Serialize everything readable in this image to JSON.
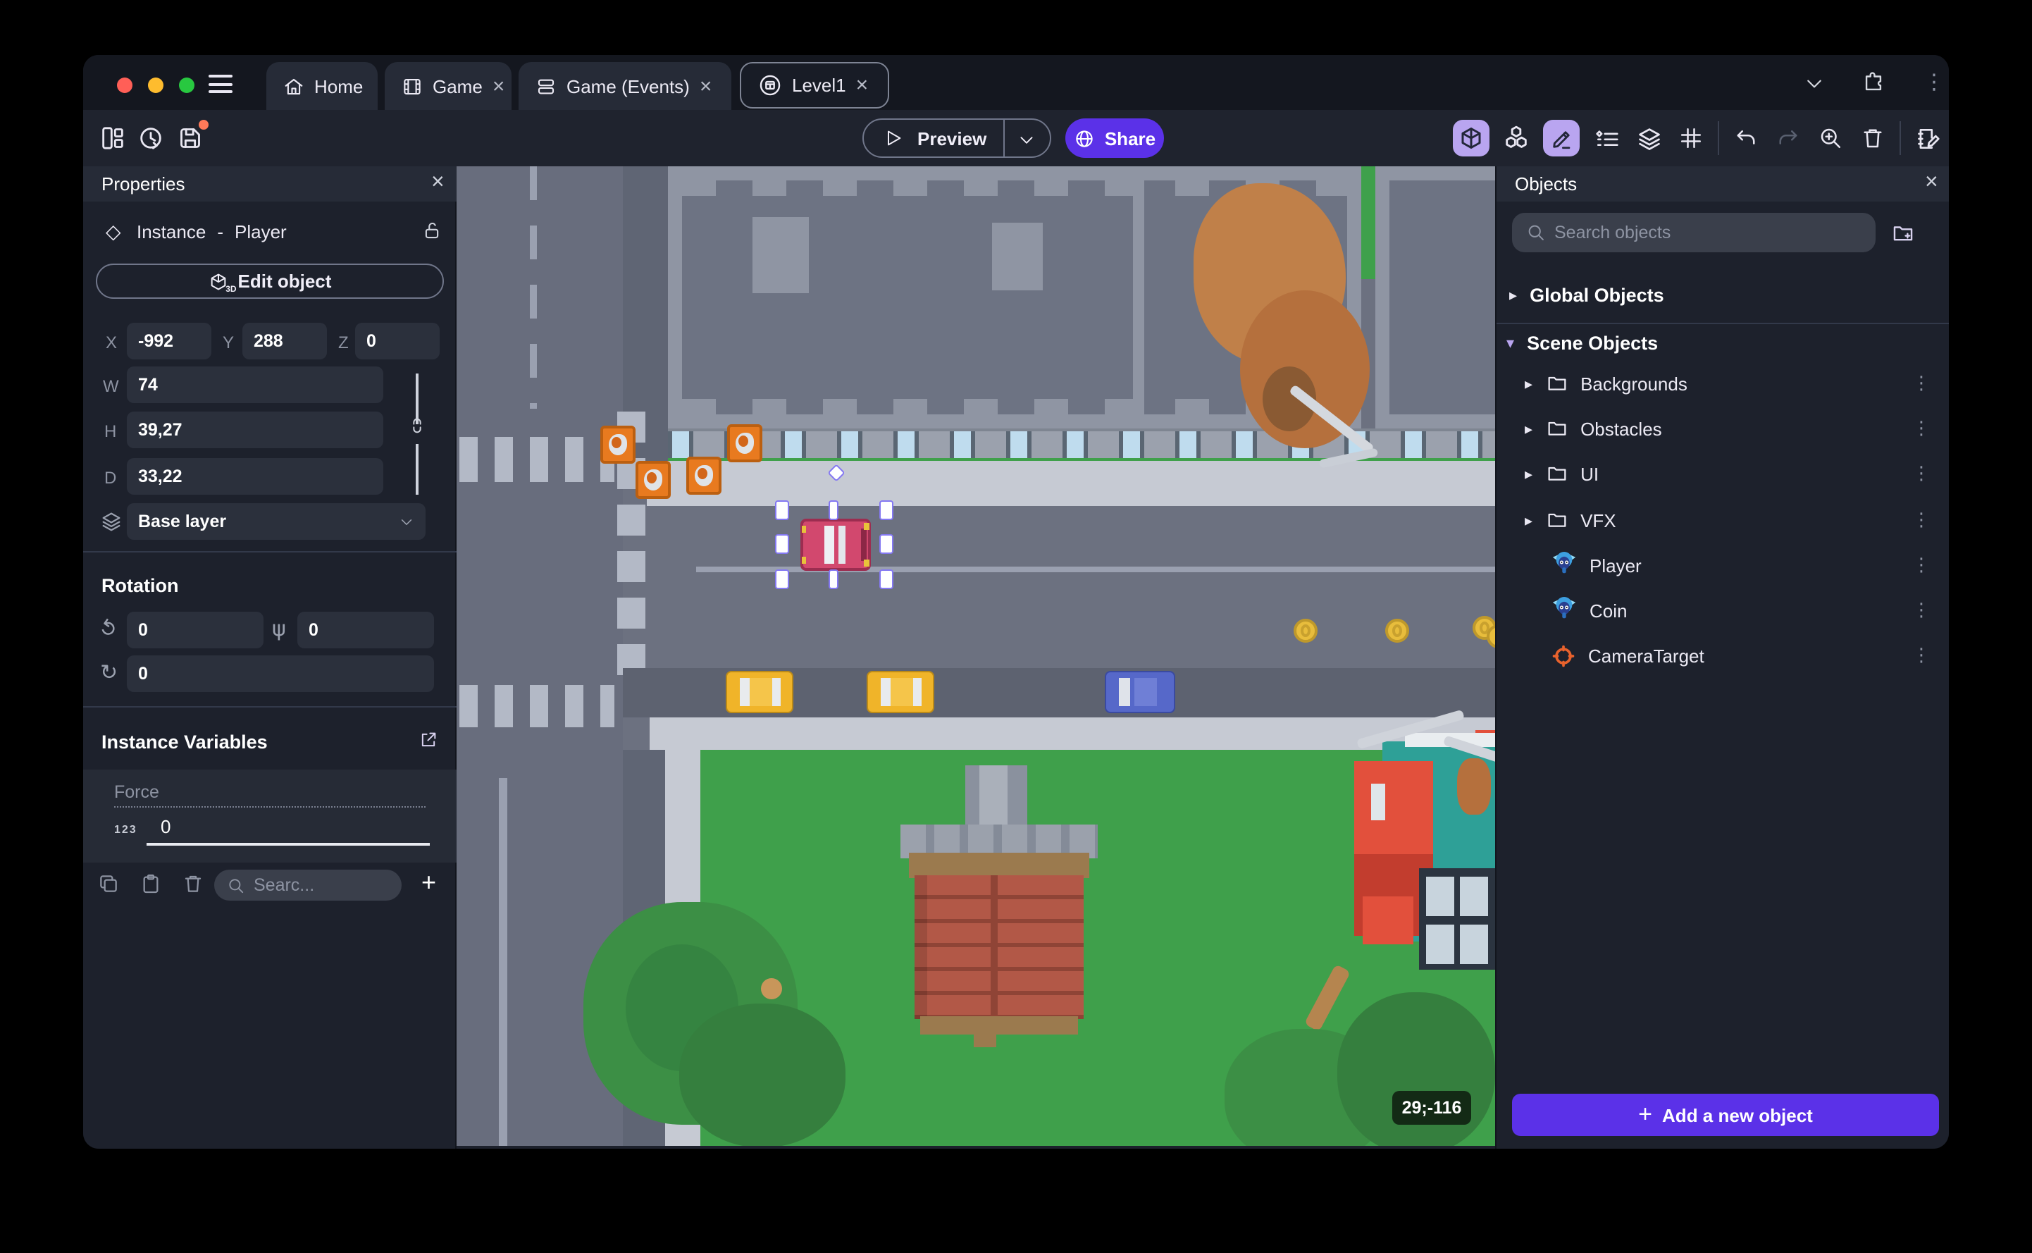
{
  "tabs": {
    "items": [
      {
        "label": "Home"
      },
      {
        "label": "Game",
        "close": "×"
      },
      {
        "label": "Game (Events)",
        "close": "×"
      },
      {
        "label": "Level1",
        "close": "×"
      }
    ]
  },
  "toolbar": {
    "preview": "Preview",
    "share": "Share"
  },
  "properties": {
    "title": "Properties",
    "close": "×",
    "instance_type": "Instance",
    "dash": "-",
    "object_name": "Player",
    "edit_object": "Edit object",
    "edit_object_icon_label": "3D",
    "x_label": "X",
    "x": "-992",
    "y_label": "Y",
    "y": "288",
    "z_label": "Z",
    "z": "0",
    "w_label": "W",
    "w": "74",
    "h_label": "H",
    "h": "39,27",
    "d_label": "D",
    "d": "33,22",
    "layer": "Base layer",
    "rotation_title": "Rotation",
    "rot_x": "0",
    "rot_y": "0",
    "rot_z": "0",
    "variables_title": "Instance Variables",
    "variable_name": "Force",
    "variable_type": "123",
    "variable_value": "0",
    "search_placeholder": "Searc...",
    "add": "+"
  },
  "objects": {
    "title": "Objects",
    "close": "×",
    "search_placeholder": "Search objects",
    "global_group": "Global Objects",
    "scene_group": "Scene Objects",
    "tree": [
      {
        "label": "Backgrounds"
      },
      {
        "label": "Obstacles"
      },
      {
        "label": "UI"
      },
      {
        "label": "VFX"
      },
      {
        "label": "Player"
      },
      {
        "label": "Coin"
      },
      {
        "label": "CameraTarget"
      }
    ],
    "add_plus": "+",
    "add_button": "Add a new object"
  },
  "canvas": {
    "coordinate_badge": "29;-116"
  },
  "icons": {
    "caret_right": "▸",
    "caret_down": "▾",
    "dots_vertical": "⋮",
    "diamond": "◇",
    "rotate_x": "↺",
    "rotate_y": "ψ",
    "rotate_z": "↻"
  },
  "colors": {
    "accent_purple": "#5b31e8",
    "active_icon_bg": "#b9a5f0",
    "selection_handle": "#8478f2",
    "notification_dot": "#ff7a59",
    "grass": "#3fa04b",
    "road": "#6c7180",
    "sidewalk": "#c6cad3",
    "brick": "#b25847",
    "teal_roof": "#2ea097",
    "taxi_yellow": "#f0b429",
    "car_blue": "#5668c9",
    "car_pink": "#d2486e",
    "coin_gold": "#e8bd3c",
    "crate_orange": "#e87a1f",
    "traffic_red": "#ff5f57",
    "traffic_yellow": "#febc2e",
    "traffic_green": "#28c840"
  }
}
